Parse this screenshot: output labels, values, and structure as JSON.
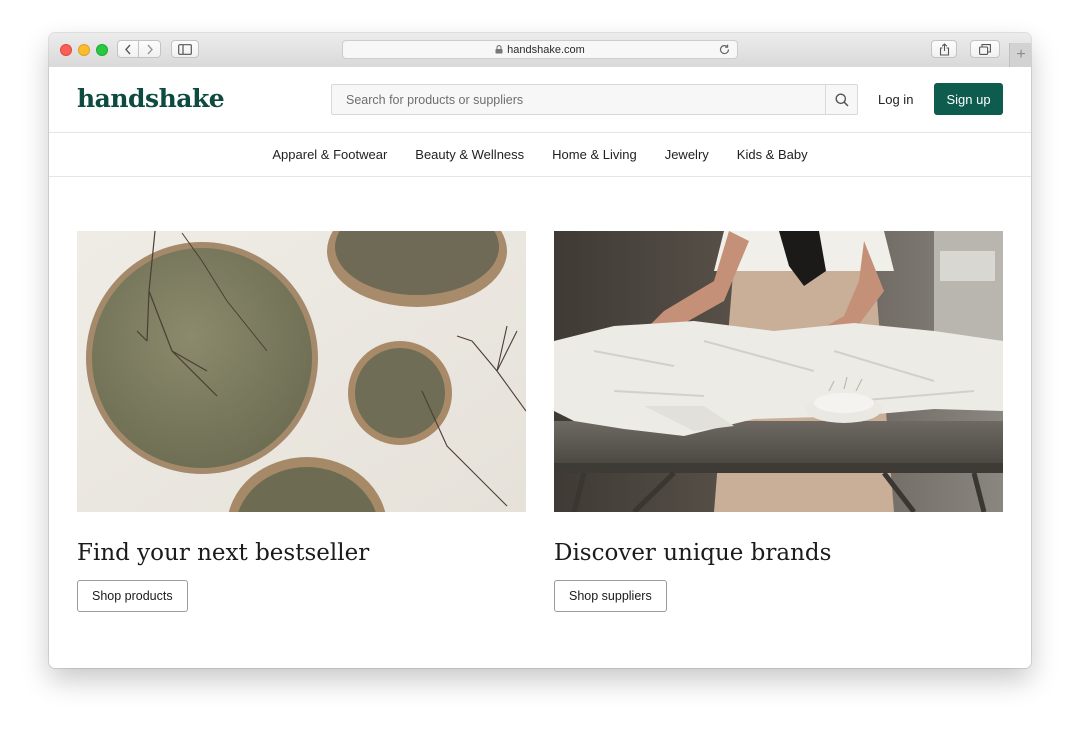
{
  "browser": {
    "url": "handshake.com"
  },
  "header": {
    "logo": "handshake",
    "search_placeholder": "Search for products or suppliers",
    "login_label": "Log in",
    "signup_label": "Sign up"
  },
  "categories": [
    {
      "label": "Apparel & Footwear"
    },
    {
      "label": "Beauty & Wellness"
    },
    {
      "label": "Home & Living"
    },
    {
      "label": "Jewelry"
    },
    {
      "label": "Kids & Baby"
    }
  ],
  "cards": [
    {
      "title": "Find your next bestseller",
      "button": "Shop products",
      "image": "ceramic-plates-photo"
    },
    {
      "title": "Discover unique brands",
      "button": "Shop suppliers",
      "image": "fabric-workshop-photo"
    }
  ],
  "colors": {
    "brand": "#0d4a40",
    "signup_bg": "#0d5c4e"
  }
}
